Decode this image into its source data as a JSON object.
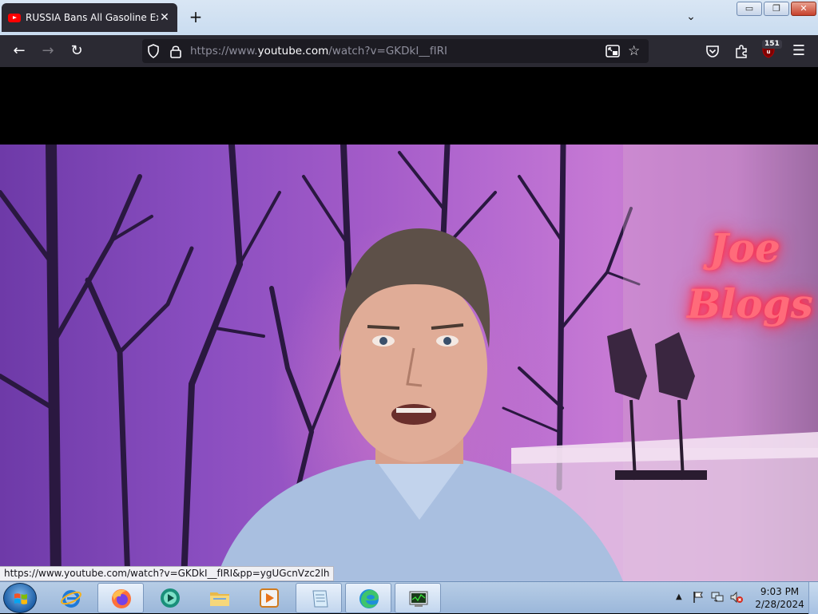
{
  "browser": {
    "tab_title": "RUSSIA Bans All Gasoline Expor",
    "tab_close": "✕",
    "new_tab": "+",
    "tab_list": "⌄",
    "window_minimize": "▭",
    "window_restore": "❐",
    "window_close": "✕",
    "url_prefix": "https://www.",
    "url_host": "youtube.com",
    "url_path": "/watch?v=GKDkI__fIRI",
    "extension_badge": "151",
    "status_url": "https://www.youtube.com/watch?v=GKDkI__fIRI&pp=ygUGcnVzc2lh"
  },
  "video": {
    "neon_line1": "Joe",
    "neon_line2": "Blogs"
  },
  "taskbar": {
    "time": "9:03 PM",
    "date": "2/28/2024",
    "items": [
      "start",
      "internet-explorer",
      "firefox",
      "media-app",
      "file-explorer",
      "media-player",
      "notepad",
      "edge",
      "task-manager"
    ]
  },
  "colors": {
    "toolbar": "#2b2a33",
    "urlbar": "#1c1b22",
    "neon": "#ff3355"
  }
}
